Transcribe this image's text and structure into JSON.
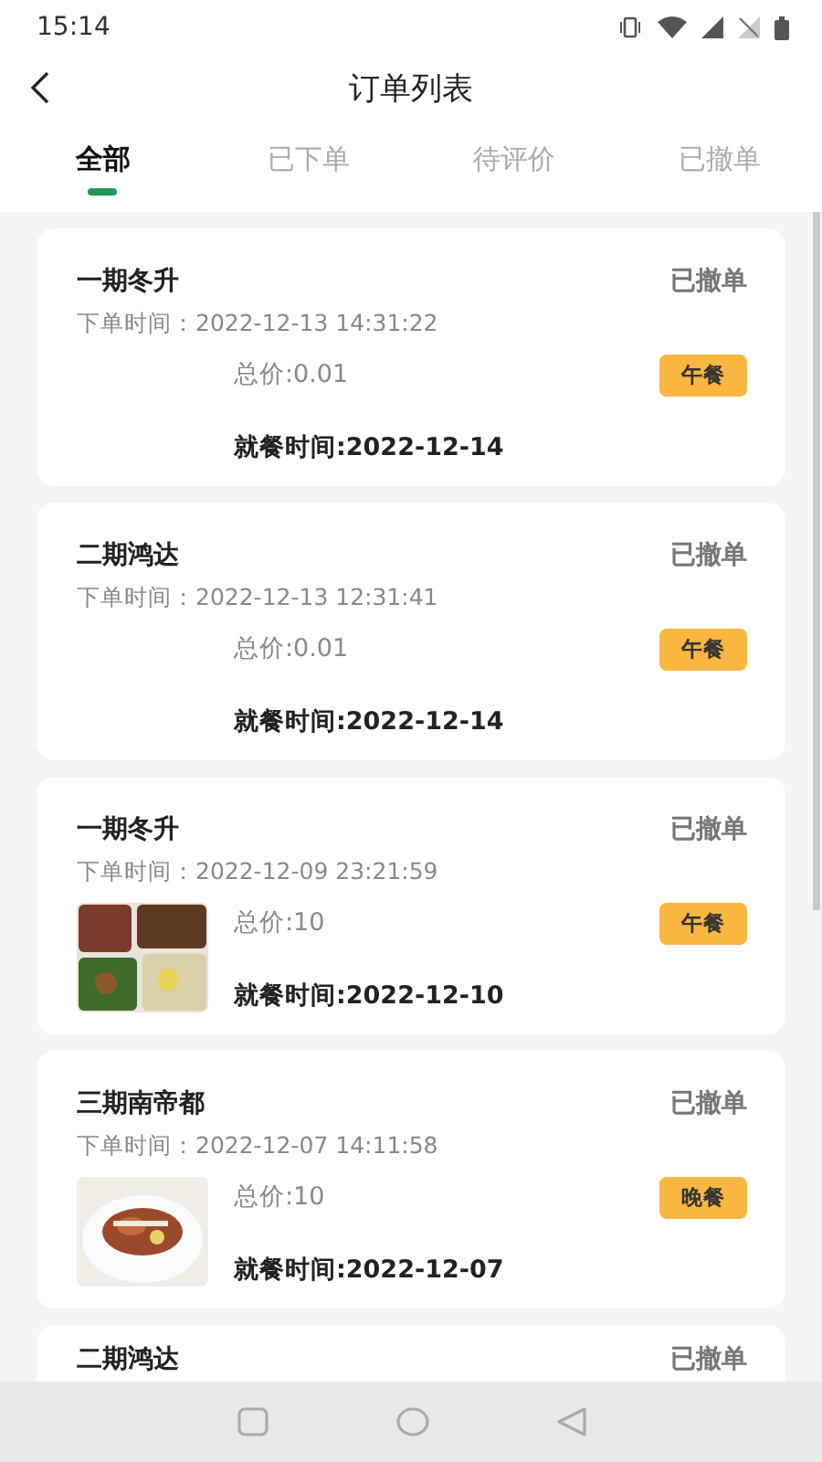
{
  "status_bar": {
    "time": "15:14"
  },
  "header": {
    "title": "订单列表"
  },
  "tabs": [
    {
      "label": "全部",
      "selected": true
    },
    {
      "label": "已下单",
      "selected": false
    },
    {
      "label": "待评价",
      "selected": false
    },
    {
      "label": "已撤单",
      "selected": false
    }
  ],
  "orders": [
    {
      "place": "一期冬升",
      "status": "已撤单",
      "order_time": "下单时间：2022-12-13 14:31:22",
      "total": "总价:0.01",
      "meal": "午餐",
      "dine_time": "就餐时间:2022-12-14",
      "photo": false
    },
    {
      "place": "二期鸿达",
      "status": "已撤单",
      "order_time": "下单时间：2022-12-13 12:31:41",
      "total": "总价:0.01",
      "meal": "午餐",
      "dine_time": "就餐时间:2022-12-14",
      "photo": false
    },
    {
      "place": "一期冬升",
      "status": "已撤单",
      "order_time": "下单时间：2022-12-09 23:21:59",
      "total": "总价:10",
      "meal": "午餐",
      "dine_time": "就餐时间:2022-12-10",
      "photo": true
    },
    {
      "place": "三期南帝都",
      "status": "已撤单",
      "order_time": "下单时间：2022-12-07 14:11:58",
      "total": "总价:10",
      "meal": "晚餐",
      "dine_time": "就餐时间:2022-12-07",
      "photo": true
    },
    {
      "place": "二期鸿达",
      "status": "已撤单"
    }
  ]
}
